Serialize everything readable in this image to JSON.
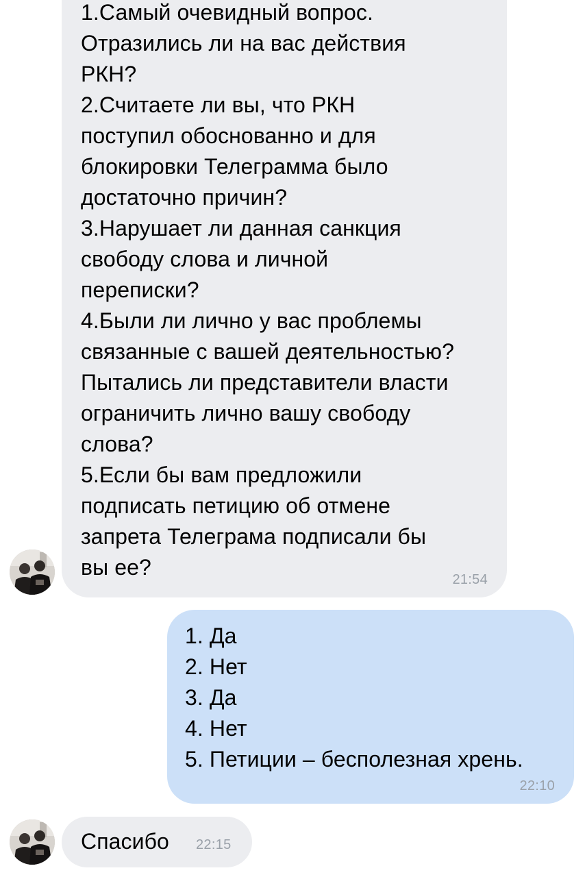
{
  "messages": [
    {
      "direction": "incoming",
      "lines": [
        "1.Самый очевидный вопрос.",
        "Отразились ли на вас действия",
        "РКН?",
        "2.Считаете ли вы, что РКН",
        "поступил обоснованно и для",
        "блокировки Телеграмма было",
        "достаточно причин?",
        "3.Нарушает ли данная санкция",
        "свободу слова и личной",
        "переписки?",
        "4.Были ли лично у вас проблемы",
        "связанные с вашей деятельностью?",
        "Пытались ли представители власти",
        "ограничить лично вашу свободу",
        "слова?",
        "5.Если бы вам предложили",
        "подписать петицию об отмене",
        "запрета Телеграма подписали бы",
        "вы ее?"
      ],
      "time": "21:54"
    },
    {
      "direction": "outgoing",
      "lines": [
        "1. Да",
        "2. Нет",
        "3. Да",
        "4. Нет",
        "5. Петиции – бесполезная хрень."
      ],
      "time": "22:10"
    },
    {
      "direction": "incoming",
      "lines": [
        "Спасибо"
      ],
      "time": "22:15"
    }
  ],
  "colors": {
    "incoming_bubble": "#ecedf0",
    "outgoing_bubble": "#cce0f8",
    "time_text": "#9aa1a9"
  },
  "icons": {
    "sender_avatar": "user-avatar-photo"
  }
}
